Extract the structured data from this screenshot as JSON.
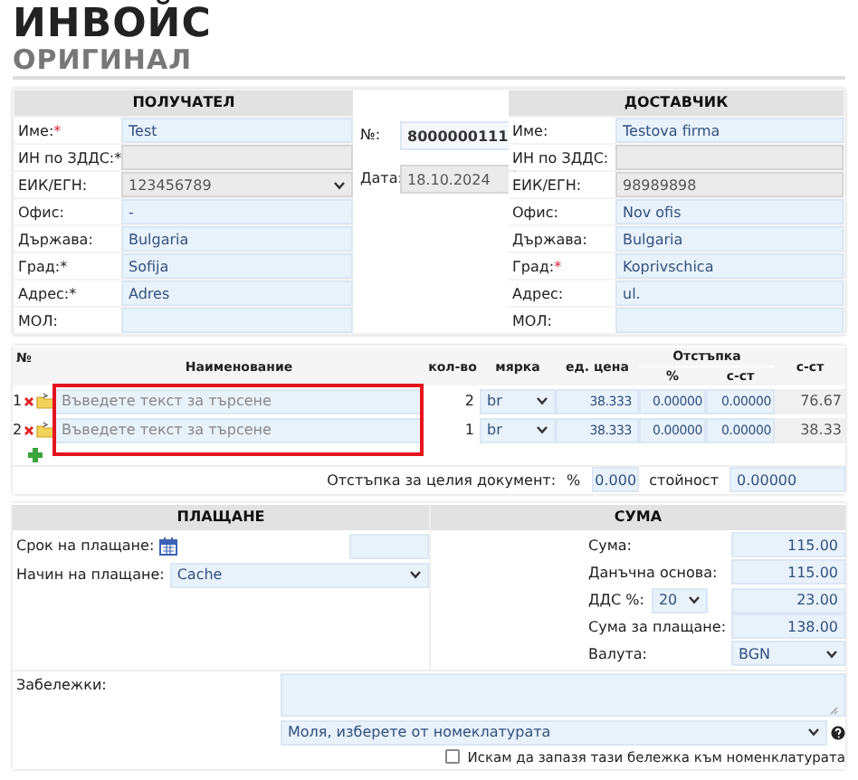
{
  "title": "ИНВОЙС",
  "subtitle": "ОРИГИНАЛ",
  "recipient": {
    "heading": "ПОЛУЧАТЕЛ",
    "fields": [
      {
        "label": "Име:",
        "mark": "*",
        "mark_red": true,
        "kind": "input",
        "value": "Test",
        "disabled": false
      },
      {
        "label": "ИН по ЗДДС:",
        "mark": "*",
        "mark_red": false,
        "kind": "input",
        "disabled": true
      },
      {
        "label": "ЕИК/ЕГН:",
        "kind": "select",
        "value": "123456789",
        "disabled": true
      },
      {
        "label": "Офис:",
        "kind": "input",
        "value": "-",
        "disabled": false
      },
      {
        "label": "Държава:",
        "kind": "input",
        "value": "Bulgaria",
        "disabled": false
      },
      {
        "label": "Град:",
        "mark": "*",
        "mark_red": false,
        "kind": "input",
        "value": "Sofija",
        "disabled": false
      },
      {
        "label": "Адрес:",
        "mark": "*",
        "mark_red": false,
        "kind": "input",
        "value": "Adres",
        "disabled": false
      },
      {
        "label": "МОЛ:",
        "kind": "input",
        "disabled": false
      }
    ]
  },
  "meta": {
    "number_label": "№:",
    "number": "8000000111",
    "date_label": "Дата:",
    "date": "18.10.2024"
  },
  "supplier": {
    "heading": "ДОСТАВЧИК",
    "fields": [
      {
        "label": "Име:",
        "kind": "input",
        "value": "Testova firma",
        "disabled": false
      },
      {
        "label": "ИН по ЗДДС:",
        "kind": "input",
        "disabled": true
      },
      {
        "label": "ЕИК/ЕГН:",
        "kind": "input",
        "value": "98989898",
        "disabled": true
      },
      {
        "label": "Офис:",
        "kind": "input",
        "value": "Nov ofis",
        "disabled": false
      },
      {
        "label": "Държава:",
        "kind": "input",
        "value": "Bulgaria",
        "disabled": false
      },
      {
        "label": "Град:",
        "mark": "*",
        "mark_red": true,
        "kind": "input",
        "value": "Koprivschica",
        "disabled": false
      },
      {
        "label": "Адрес:",
        "kind": "input",
        "value": "ul.",
        "disabled": false
      },
      {
        "label": "МОЛ:",
        "kind": "input",
        "disabled": false
      }
    ]
  },
  "items": {
    "columns": {
      "no": "№",
      "name": "Наименование",
      "qty": "кол-во",
      "unit": "мярка",
      "price": "ед. цена",
      "discount": "Отстъпка",
      "discount_pct": "%",
      "discount_value": "с-ст",
      "total": "с-ст"
    },
    "rows": [
      {
        "no": "1",
        "placeholder": "Въведете текст за търсене",
        "qty": "2",
        "unit": "br",
        "price": "38.333",
        "discount_pct": "0.00000",
        "discount_value": "0.00000",
        "total": "76.67"
      },
      {
        "no": "2",
        "placeholder": "Въведете текст за търсене",
        "qty": "1",
        "unit": "br",
        "price": "38.333",
        "discount_pct": "0.00000",
        "discount_value": "0.00000",
        "total": "38.33"
      }
    ],
    "highlighted": true,
    "doc_discount": {
      "label": "Отстъпка за целия документ:",
      "pct_label": "%",
      "pct": "0.000",
      "value_label": "стойност",
      "value": "0.00000"
    }
  },
  "payment": {
    "heading": "ПЛАЩАНЕ",
    "due_label": "Срок на плащане:",
    "method_label": "Начин на плащане:",
    "method": "Cache"
  },
  "sum": {
    "heading": "СУМА",
    "rows": [
      {
        "kind": "input",
        "label": "Сума:",
        "value": "115.00"
      },
      {
        "kind": "input",
        "label": "Данъчна основа:",
        "value": "115.00"
      },
      {
        "kind": "vat",
        "label": "ДДС %:",
        "rate": "20",
        "value": "23.00"
      },
      {
        "kind": "input",
        "label": "Сума за плащане:",
        "value": "138.00"
      },
      {
        "kind": "select",
        "label": "Валута:",
        "value": "BGN"
      }
    ]
  },
  "notes": {
    "label": "Забележки:",
    "select": "Моля, изберете от номеклатурата",
    "save_label": "Искам да запазя тази бележка към номенклатурата",
    "save_checked": false
  }
}
